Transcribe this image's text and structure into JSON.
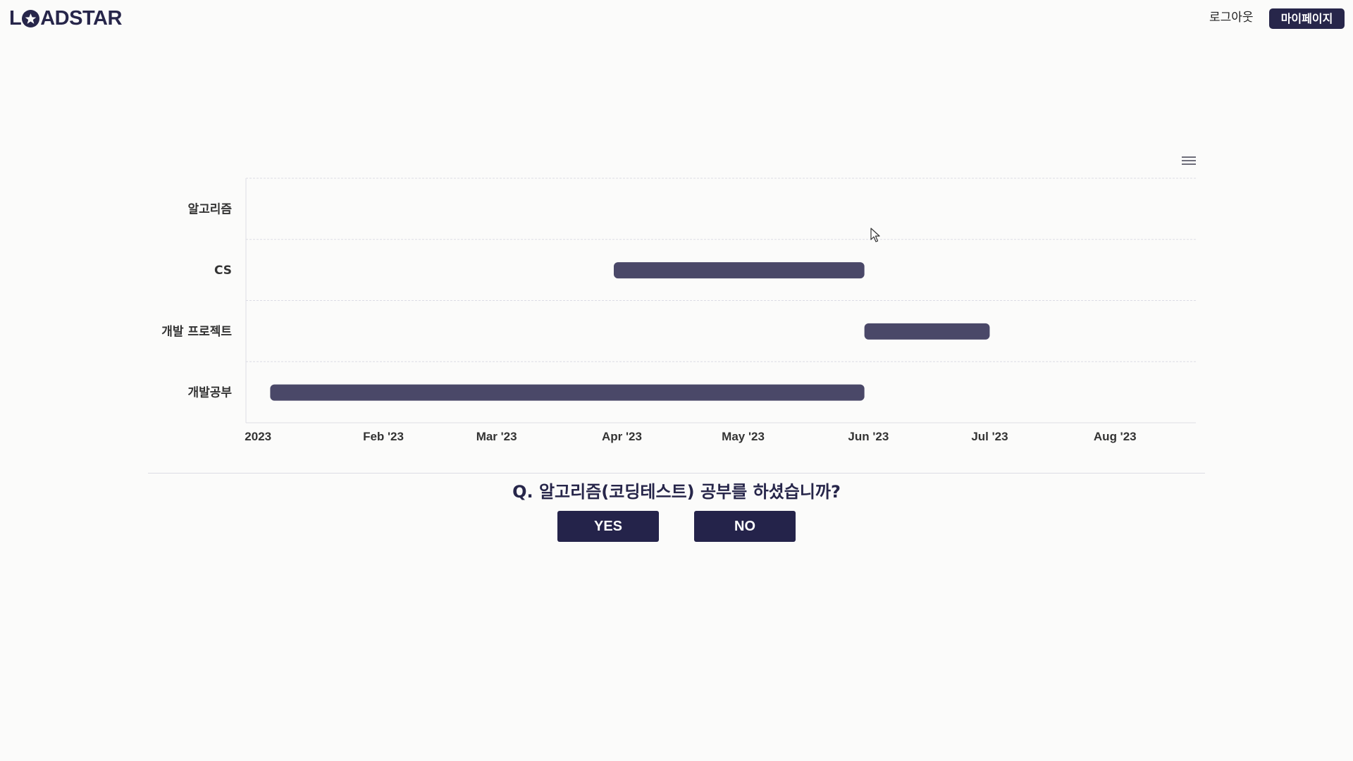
{
  "header": {
    "logo": [
      "L",
      "ADSTAR"
    ],
    "logout_label": "로그아웃",
    "mypage_label": "마이페이지"
  },
  "colors": {
    "brand": "#27264a",
    "bar": "#4a4868",
    "grid": "#dcdce4",
    "background": "#fbfbfa"
  },
  "chart_data": {
    "type": "bar",
    "orientation": "horizontal-timeline",
    "title": "",
    "xlabel": "",
    "ylabel": "",
    "categories": [
      "알고리즘",
      "CS",
      "개발 프로젝트",
      "개발공부"
    ],
    "x_ticks": [
      "2023",
      "Feb '23",
      "Mar '23",
      "Apr '23",
      "May '23",
      "Jun '23",
      "Jul '23",
      "Aug '23"
    ],
    "xlim": [
      "2022-12-29",
      "2023-08-21"
    ],
    "ranges": [
      {
        "category": "알고리즘",
        "start": null,
        "end": null
      },
      {
        "category": "CS",
        "start": "2023-03-30",
        "end": "2023-05-31"
      },
      {
        "category": "개발 프로젝트",
        "start": "2023-05-31",
        "end": "2023-07-01"
      },
      {
        "category": "개발공부",
        "start": "2023-01-04",
        "end": "2023-05-31"
      }
    ],
    "grid": true,
    "legend": "none"
  },
  "question": {
    "text": "Q. 알고리즘(코딩테스트) 공부를 하셨습니까?",
    "yes_label": "YES",
    "no_label": "NO"
  },
  "icons": {
    "chart_menu": "hamburger-menu-icon",
    "cursor": "mouse-pointer-icon"
  }
}
